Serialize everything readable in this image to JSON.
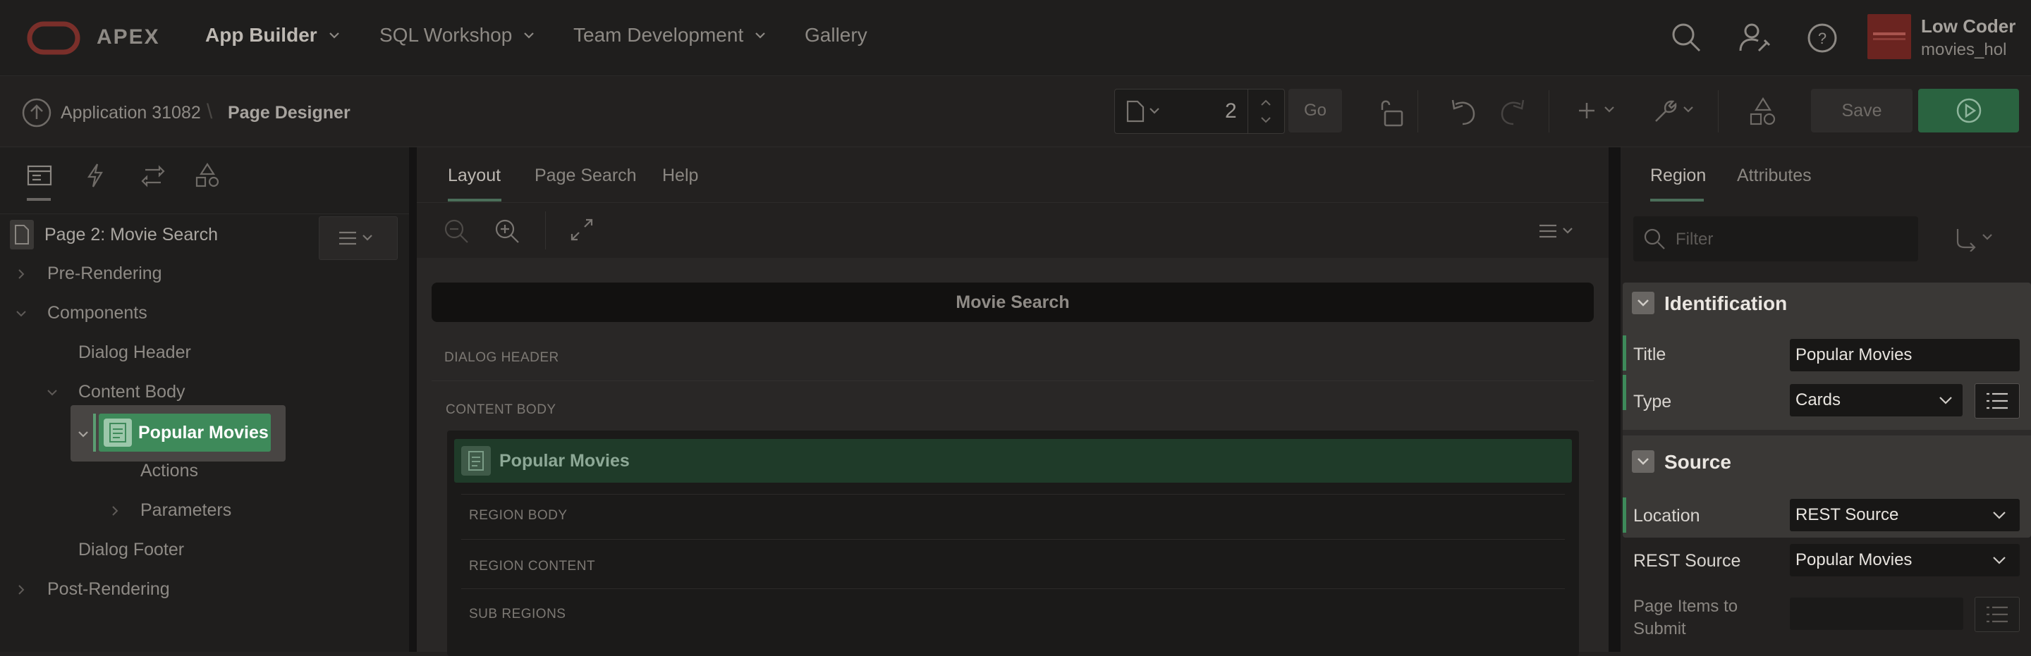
{
  "topnav": {
    "brand": "APEX",
    "items": [
      {
        "label": "App Builder",
        "has_menu": true
      },
      {
        "label": "SQL Workshop",
        "has_menu": true
      },
      {
        "label": "Team Development",
        "has_menu": true
      },
      {
        "label": "Gallery",
        "has_menu": false
      }
    ],
    "user": {
      "name": "Low Coder",
      "workspace": "movies_hol",
      "avatar_icon": "oracle-logo-icon"
    }
  },
  "toolbar": {
    "breadcrumb": {
      "app": "Application 31082",
      "page": "Page Designer"
    },
    "page_number": "2",
    "go_label": "Go",
    "save_label": "Save"
  },
  "left": {
    "page_title": "Page 2: Movie Search",
    "tree": {
      "pre_rendering": "Pre-Rendering",
      "components": "Components",
      "dialog_header": "Dialog Header",
      "content_body": "Content Body",
      "popular_movies": "Popular Movies",
      "actions": "Actions",
      "parameters": "Parameters",
      "dialog_footer": "Dialog Footer",
      "post_rendering": "Post-Rendering"
    }
  },
  "center": {
    "tabs": [
      "Layout",
      "Page Search",
      "Help"
    ],
    "page_header": "Movie Search",
    "dialog_header": "DIALOG HEADER",
    "content_body": "CONTENT BODY",
    "region_title": "Popular Movies",
    "region_body": "REGION BODY",
    "region_content": "REGION CONTENT",
    "sub_regions": "SUB REGIONS"
  },
  "right": {
    "tabs": [
      "Region",
      "Attributes"
    ],
    "filter_placeholder": "Filter",
    "identification": {
      "title": "Identification",
      "title_label": "Title",
      "title_value": "Popular Movies",
      "type_label": "Type",
      "type_value": "Cards"
    },
    "source": {
      "title": "Source",
      "location_label": "Location",
      "location_value": "REST Source",
      "rest_label": "REST Source",
      "rest_value": "Popular Movies",
      "page_items_label_1": "Page Items to",
      "page_items_label_2": "Submit"
    }
  },
  "colors": {
    "accent_green": "#3e8a5a",
    "run_green": "#2c6a43",
    "highlight_panel": "#3a3836"
  }
}
